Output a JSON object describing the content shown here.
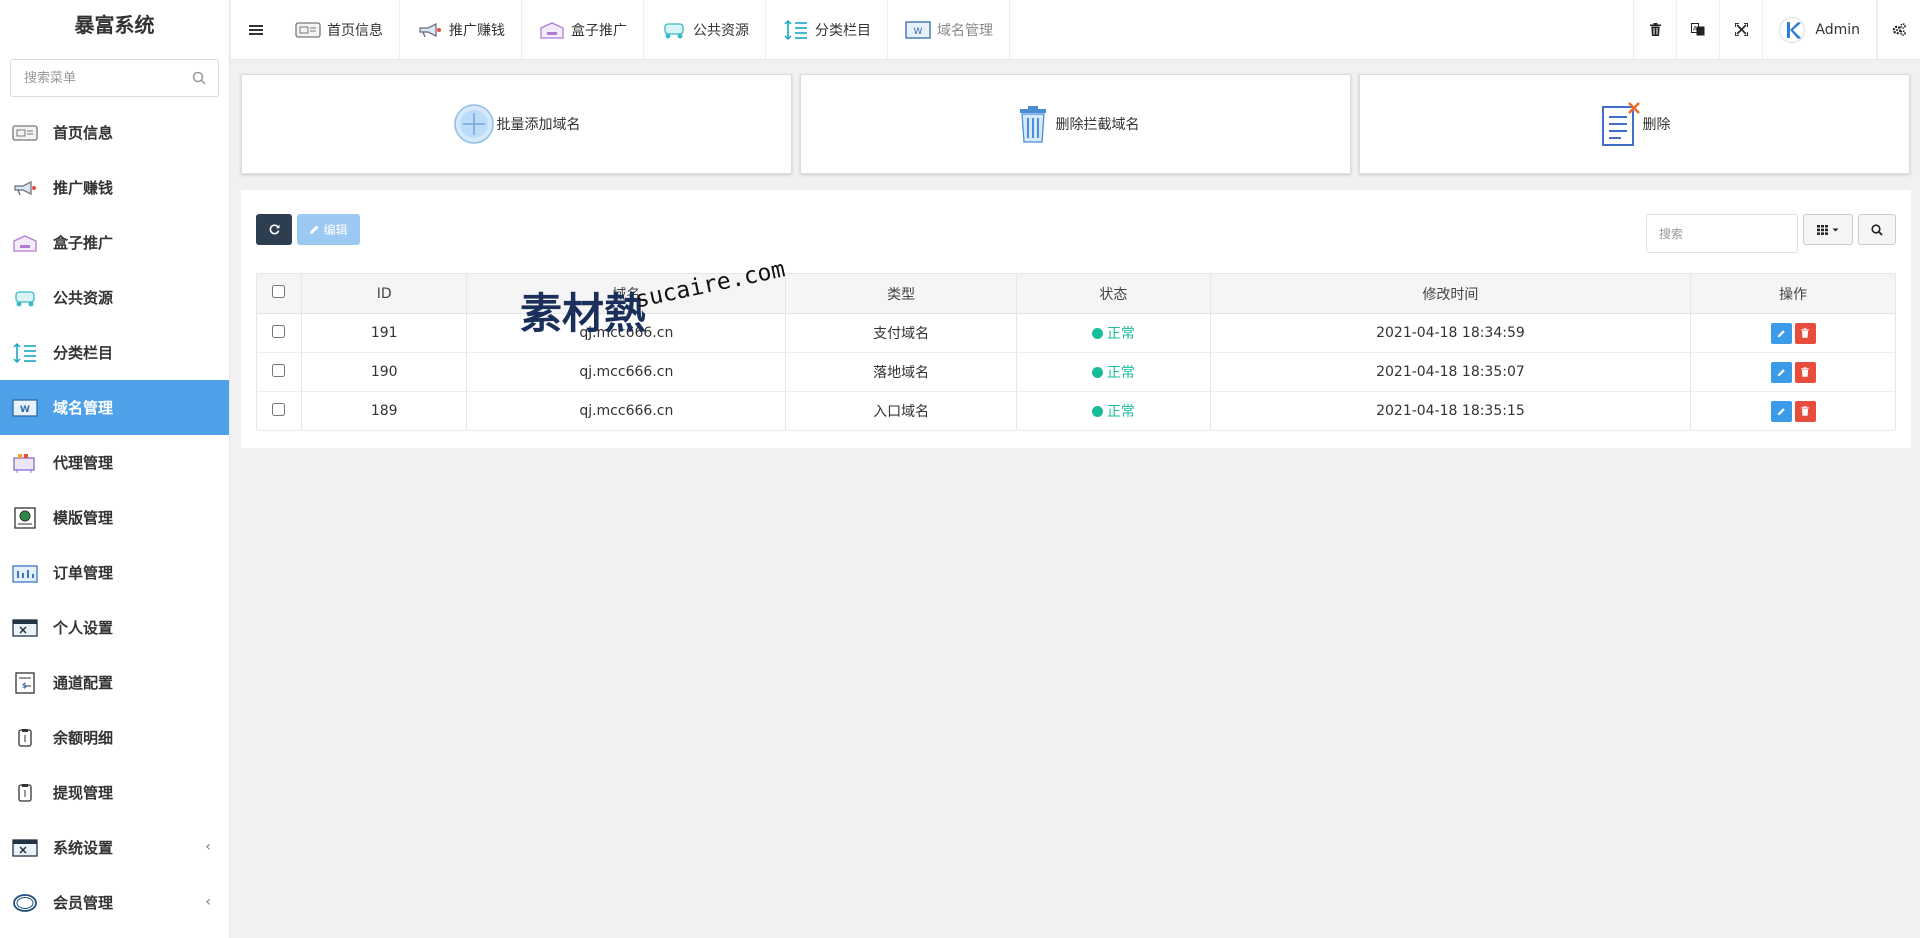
{
  "app": {
    "title": "暴富系统"
  },
  "sidebar": {
    "search_placeholder": "搜索菜单",
    "items": [
      {
        "label": "首页信息",
        "icon": "home-card-icon",
        "active": false
      },
      {
        "label": "推广赚钱",
        "icon": "megaphone-icon",
        "active": false
      },
      {
        "label": "盒子推广",
        "icon": "box-icon",
        "active": false
      },
      {
        "label": "公共资源",
        "icon": "resource-icon",
        "active": false
      },
      {
        "label": "分类栏目",
        "icon": "sort-icon",
        "active": false
      },
      {
        "label": "域名管理",
        "icon": "domain-icon",
        "active": true
      },
      {
        "label": "代理管理",
        "icon": "agent-icon",
        "active": false
      },
      {
        "label": "模版管理",
        "icon": "template-icon",
        "active": false
      },
      {
        "label": "订单管理",
        "icon": "order-icon",
        "active": false
      },
      {
        "label": "个人设置",
        "icon": "profile-icon",
        "active": false
      },
      {
        "label": "通道配置",
        "icon": "channel-icon",
        "active": false
      },
      {
        "label": "余额明细",
        "icon": "balance-icon",
        "active": false
      },
      {
        "label": "提现管理",
        "icon": "withdraw-icon",
        "active": false
      },
      {
        "label": "系统设置",
        "icon": "system-icon",
        "active": false,
        "submenu_caret": "‹"
      },
      {
        "label": "会员管理",
        "icon": "member-icon",
        "active": false,
        "submenu_caret": "‹"
      }
    ]
  },
  "topbar": {
    "tabs": [
      {
        "label": "首页信息",
        "icon": "home-card-icon"
      },
      {
        "label": "推广赚钱",
        "icon": "megaphone-icon"
      },
      {
        "label": "盒子推广",
        "icon": "box-icon"
      },
      {
        "label": "公共资源",
        "icon": "resource-icon"
      },
      {
        "label": "分类栏目",
        "icon": "sort-icon"
      },
      {
        "label": "域名管理",
        "icon": "domain-icon"
      }
    ],
    "user_name": "Admin"
  },
  "cards": [
    {
      "label": "批量添加域名",
      "icon": "add-circle-icon"
    },
    {
      "label": "删除拦截域名",
      "icon": "trash-bin-icon"
    },
    {
      "label": "删除",
      "icon": "doc-delete-icon"
    }
  ],
  "toolbar": {
    "edit_label": "编辑",
    "search_placeholder": "搜索"
  },
  "table": {
    "headers": [
      "ID",
      "域名",
      "类型",
      "状态",
      "修改时间",
      "操作"
    ],
    "rows": [
      {
        "id": "191",
        "domain": "qj.mcc666.cn",
        "type": "支付域名",
        "type_class": "type-pay",
        "status": "正常",
        "time": "2021-04-18 18:34:59"
      },
      {
        "id": "190",
        "domain": "qj.mcc666.cn",
        "type": "落地域名",
        "type_class": "type-land",
        "status": "正常",
        "time": "2021-04-18 18:35:07"
      },
      {
        "id": "189",
        "domain": "qj.mcc666.cn",
        "type": "入口域名",
        "type_class": "",
        "status": "正常",
        "time": "2021-04-18 18:35:15"
      }
    ]
  },
  "watermark": {
    "cn": "素材熱",
    "en": "sucaire.com"
  },
  "colors": {
    "accent": "#4ea1e8",
    "dark": "#2c3e50",
    "success": "#18bc9c",
    "danger": "#e74c3c"
  }
}
